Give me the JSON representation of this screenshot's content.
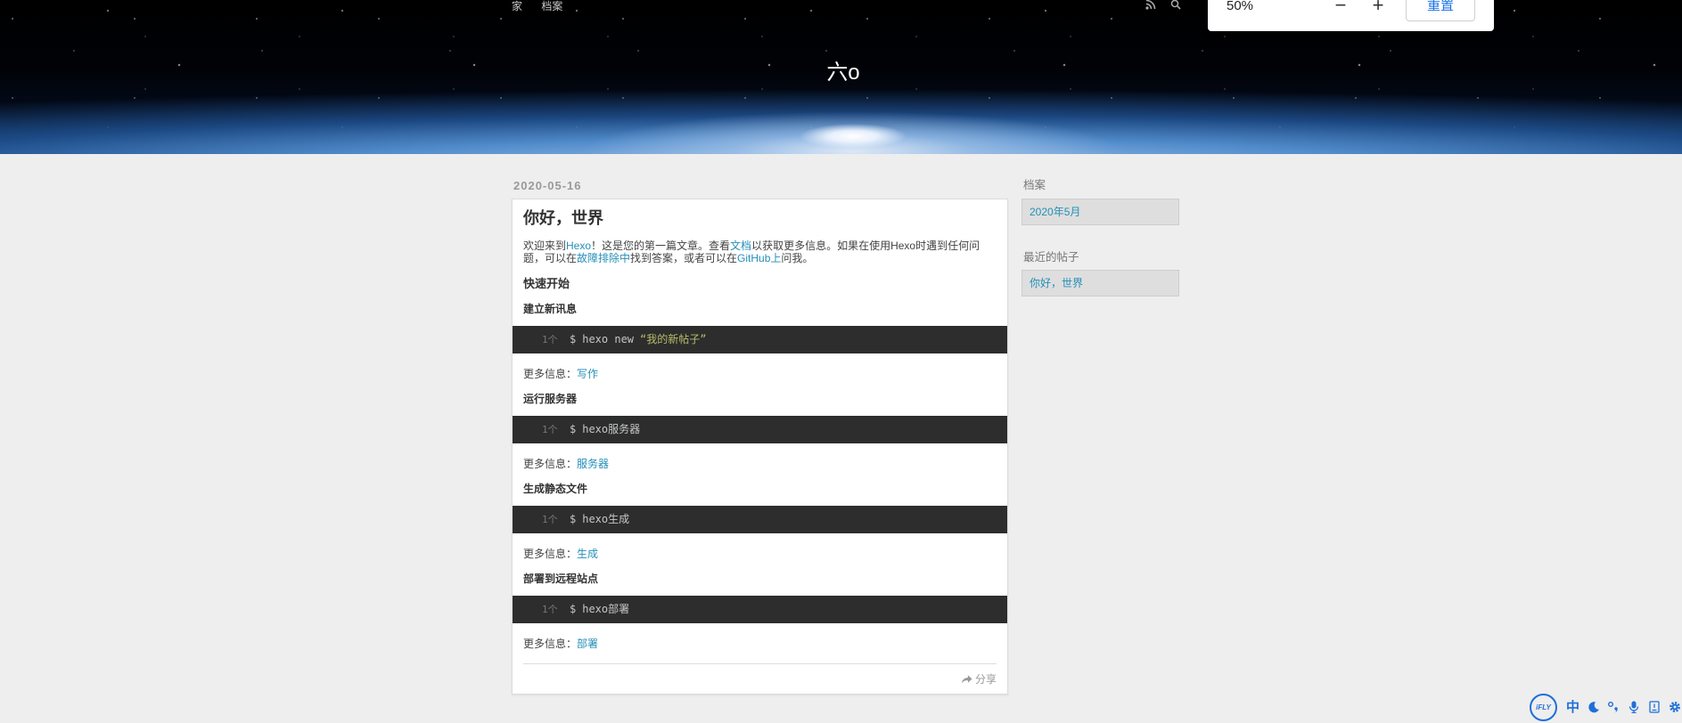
{
  "nav": {
    "items": [
      {
        "label": "家"
      },
      {
        "label": "档案"
      }
    ]
  },
  "header": {
    "title": "六o",
    "icons": [
      "rss-icon",
      "search-icon"
    ]
  },
  "zoom_popup": {
    "level": "50%",
    "decrease": "−",
    "increase": "+",
    "reset": "重置"
  },
  "post": {
    "date": "2020-05-16",
    "title": "你好，世界",
    "intro": [
      {
        "text": "欢迎来到"
      },
      {
        "link": "Hexo"
      },
      {
        "text": "！这是您的第一篇文章。查看"
      },
      {
        "link": "文档"
      },
      {
        "text": "以获取更多信息。如果在使用Hexo时遇到任何问题，可以在"
      },
      {
        "link": "故障排除中"
      },
      {
        "text": "找到答案，或者可以在"
      },
      {
        "link": "GitHub上"
      },
      {
        "text": "问我。"
      }
    ],
    "quick_start": "快速开始",
    "sections": [
      {
        "heading": "建立新讯息",
        "code": {
          "line_number": "1个",
          "prompt": "$",
          "command": "hexo new",
          "argument": "“我的新帖子”"
        },
        "more_label": "更多信息：",
        "more_link": "写作"
      },
      {
        "heading": "运行服务器",
        "code": {
          "line_number": "1个",
          "prompt": "$",
          "command": "hexo服务器"
        },
        "more_label": "更多信息：",
        "more_link": "服务器"
      },
      {
        "heading": "生成静态文件",
        "code": {
          "line_number": "1个",
          "prompt": "$",
          "command": "hexo生成"
        },
        "more_label": "更多信息：",
        "more_link": "生成"
      },
      {
        "heading": "部署到远程站点",
        "code": {
          "line_number": "1个",
          "prompt": "$",
          "command": "hexo部署"
        },
        "more_label": "更多信息：",
        "more_link": "部署"
      }
    ],
    "share": "分享",
    "share_icon": "share-icon"
  },
  "sidebar": {
    "archives": {
      "heading": "档案",
      "items": [
        "2020年5月"
      ]
    },
    "recent_posts": {
      "heading": "最近的帖子",
      "items": [
        "你好，世界"
      ]
    }
  },
  "ifly_toolbar": {
    "logo": "iFLY",
    "language": "中",
    "icons": [
      "moon-icon",
      "punctuation-icon",
      "microphone-icon",
      "toolbox-icon",
      "gear-icon"
    ]
  },
  "colors": {
    "link": "#258fb8",
    "code_background": "#2d2d2d",
    "code_string": "#b5bd68",
    "page_background": "#eeeeee",
    "ifly_blue": "#1e6fd9"
  }
}
